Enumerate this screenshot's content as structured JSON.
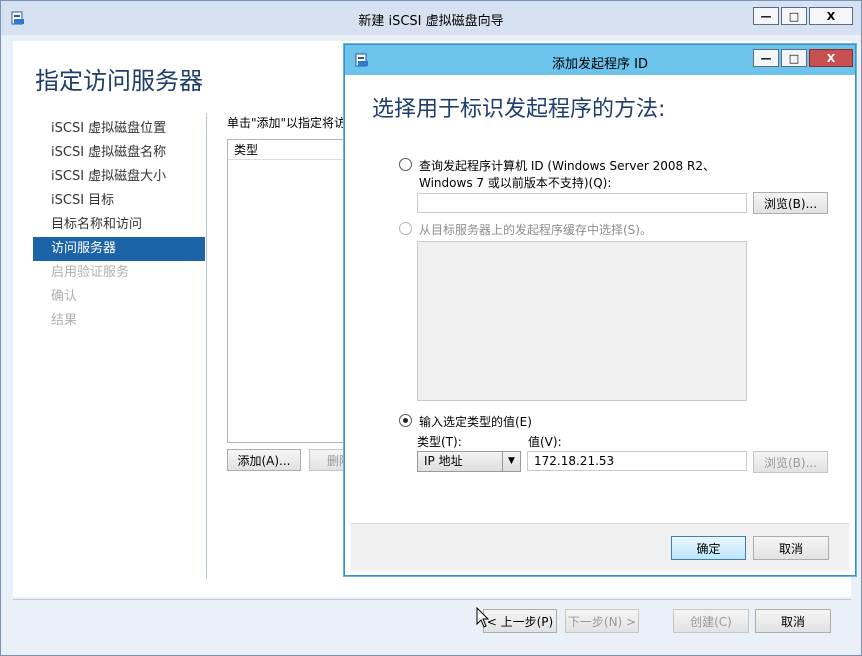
{
  "main_window": {
    "title": "新建 iSCSI 虚拟磁盘向导",
    "heading": "指定访问服务器",
    "nav_items": [
      {
        "label": "iSCSI 虚拟磁盘位置"
      },
      {
        "label": "iSCSI 虚拟磁盘名称"
      },
      {
        "label": "iSCSI 虚拟磁盘大小"
      },
      {
        "label": "iSCSI 目标"
      },
      {
        "label": "目标名称和访问"
      },
      {
        "label": "访问服务器"
      },
      {
        "label": "启用验证服务"
      },
      {
        "label": "确认"
      },
      {
        "label": "结果"
      }
    ],
    "instruction": "单击\"添加\"以指定将访",
    "list_header": "类型",
    "add_button": "添加(A)...",
    "delete_button": "删除",
    "footer": {
      "prev": "< 上一步(P)",
      "next": "下一步(N) >",
      "create": "创建(C)",
      "cancel": "取消"
    },
    "window_buttons": {
      "minimize": "—",
      "maximize": "□",
      "close": "X"
    }
  },
  "dialog": {
    "title": "添加发起程序 ID",
    "heading": "选择用于标识发起程序的方法:",
    "option_query": {
      "label_line1": "查询发起程序计算机 ID (Windows Server 2008 R2、",
      "label_line2": "Windows 7 或以前版本不支持)(Q):",
      "value": "",
      "browse": "浏览(B)..."
    },
    "option_cache": {
      "label": "从目标服务器上的发起程序缓存中选择(S)。"
    },
    "option_manual": {
      "label": "输入选定类型的值(E)",
      "type_label": "类型(T):",
      "value_label": "值(V):",
      "type_selected": "IP 地址",
      "value": "172.18.21.53",
      "browse": "浏览(B)..."
    },
    "ok": "确定",
    "cancel": "取消",
    "window_buttons": {
      "minimize": "—",
      "maximize": "□",
      "close": "X"
    }
  }
}
